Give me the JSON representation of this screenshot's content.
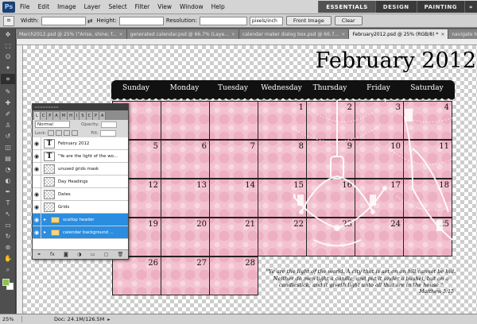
{
  "app": {
    "logo": "Ps",
    "menu": [
      "File",
      "Edit",
      "Image",
      "Layer",
      "Select",
      "Filter",
      "View",
      "Window",
      "Help"
    ],
    "workspaces": [
      "ESSENTIALS",
      "DESIGN",
      "PAINTING"
    ],
    "workspaces_more": "»"
  },
  "options": {
    "width_label": "Width:",
    "height_label": "Height:",
    "resolution_label": "Resolution:",
    "resolution_unit": "pixels/inch",
    "front_image": "Front Image",
    "clear": "Clear"
  },
  "tabs": [
    {
      "label": "March2012.psd @ 25% (\"Arise, shine; f...",
      "active": false
    },
    {
      "label": "generated calendar.psd @ 66.7% (Laye...",
      "active": false
    },
    {
      "label": "calendar maker dialog box.psd @ 66.7...",
      "active": false
    },
    {
      "label": "February2012.psd @ 25% (RGB/8) *",
      "active": true
    },
    {
      "label": "navigate to file scripts calen...",
      "active": false
    }
  ],
  "tools": [
    "move-icon",
    "marquee-icon",
    "lasso-icon",
    "magic-wand-icon",
    "crop-icon",
    "eyedropper-icon",
    "healing-icon",
    "brush-icon",
    "stamp-icon",
    "history-brush-icon",
    "eraser-icon",
    "gradient-icon",
    "blur-icon",
    "dodge-icon",
    "pen-icon",
    "type-icon",
    "path-select-icon",
    "shape-icon",
    "3d-rotate-icon",
    "3d-orbit-icon",
    "hand-icon",
    "zoom-icon"
  ],
  "tool_glyphs": [
    "✥",
    "⬚",
    "ʘ",
    "✦",
    "⌗",
    "✎",
    "✚",
    "✐",
    "♙",
    "↺",
    "◫",
    "▤",
    "◔",
    "◐",
    "✒",
    "T",
    "↖",
    "▭",
    "↻",
    "⊛",
    "✋",
    "⌕"
  ],
  "colors": {
    "foreground": "#8bc34a",
    "background": "#ffffff",
    "calendar_pink": "#f3c2d0",
    "header": "#111111",
    "layer_selected": "#2a8de0"
  },
  "calendar": {
    "title": "February 2012",
    "days": [
      "Sunday",
      "Monday",
      "Tuesday",
      "Wednesday",
      "Thursday",
      "Friday",
      "Saturday"
    ],
    "weeks": [
      [
        "",
        "",
        "",
        "1",
        "2",
        "3",
        "4"
      ],
      [
        "5",
        "6",
        "7",
        "8",
        "9",
        "10",
        "11"
      ],
      [
        "12",
        "13",
        "14",
        "15",
        "16",
        "17",
        "18"
      ],
      [
        "19",
        "20",
        "21",
        "22",
        "23",
        "24",
        "25"
      ],
      [
        "26",
        "27",
        "28",
        null,
        null,
        null,
        null
      ]
    ],
    "quote": "\"Ye are the light of the world.  A city that is set on an hill cannot be hid. Neither do men light a candle, and put it under a bushel, but on a candlestick; and it giveth light unto all that are in the house.\"",
    "quote_ref": "Matthew 5:15"
  },
  "layers_panel": {
    "tab_labels": [
      "L",
      "C",
      "P",
      "A",
      "M",
      "H",
      "I",
      "S",
      "C",
      "P",
      "A"
    ],
    "blend_mode": "Normal",
    "opacity_label": "Opacity:",
    "lock_label": "Lock:",
    "fill_label": "Fill:",
    "layers": [
      {
        "name": "February 2012",
        "kind": "text",
        "visible": true,
        "selected": false,
        "folder": false
      },
      {
        "name": "\"Ye are the light of the wo...",
        "kind": "text",
        "visible": true,
        "selected": false,
        "folder": false
      },
      {
        "name": "unused grids mask",
        "kind": "pixel",
        "visible": true,
        "selected": false,
        "folder": false
      },
      {
        "name": "Day Headings",
        "kind": "pixel",
        "visible": false,
        "selected": false,
        "folder": false
      },
      {
        "name": "Dates",
        "kind": "pixel",
        "visible": true,
        "selected": false,
        "folder": false
      },
      {
        "name": "Grids",
        "kind": "pixel",
        "visible": true,
        "selected": false,
        "folder": false
      },
      {
        "name": "scallop header",
        "kind": "group",
        "visible": true,
        "selected": true,
        "folder": true
      },
      {
        "name": "calendar background ...",
        "kind": "group",
        "visible": true,
        "selected": true,
        "folder": true
      }
    ],
    "footer_icons": [
      "link-icon",
      "fx-icon",
      "mask-icon",
      "adjustment-icon",
      "folder-icon",
      "new-layer-icon",
      "trash-icon"
    ],
    "footer_glyphs": [
      "⚭",
      "fx",
      "◙",
      "◑",
      "▭",
      "▢",
      "🗑"
    ]
  },
  "status": {
    "zoom": "25%",
    "doc": "Doc: 24.1M/126.5M"
  }
}
